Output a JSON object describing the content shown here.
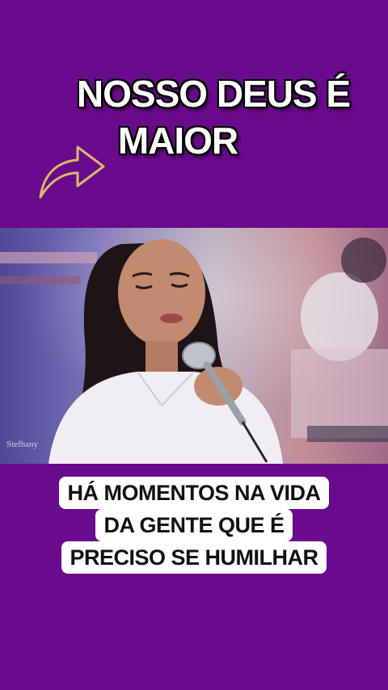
{
  "header": {
    "title_line1": "NOSSO DEUS  É",
    "title_line2": "MAIOR"
  },
  "icons": {
    "share_arrow": "share-arrow-icon"
  },
  "video": {
    "watermark": "Stefhany"
  },
  "caption": {
    "lines": [
      "HÁ MOMENTOS NA VIDA",
      "DA GENTE QUE É",
      "PRECISO SE HUMILHAR"
    ]
  },
  "colors": {
    "background": "#6a0a8c",
    "title_text": "#ffffff",
    "caption_bg": "#ffffff",
    "caption_text": "#111111",
    "arrow_stroke": "#d8b96a"
  }
}
